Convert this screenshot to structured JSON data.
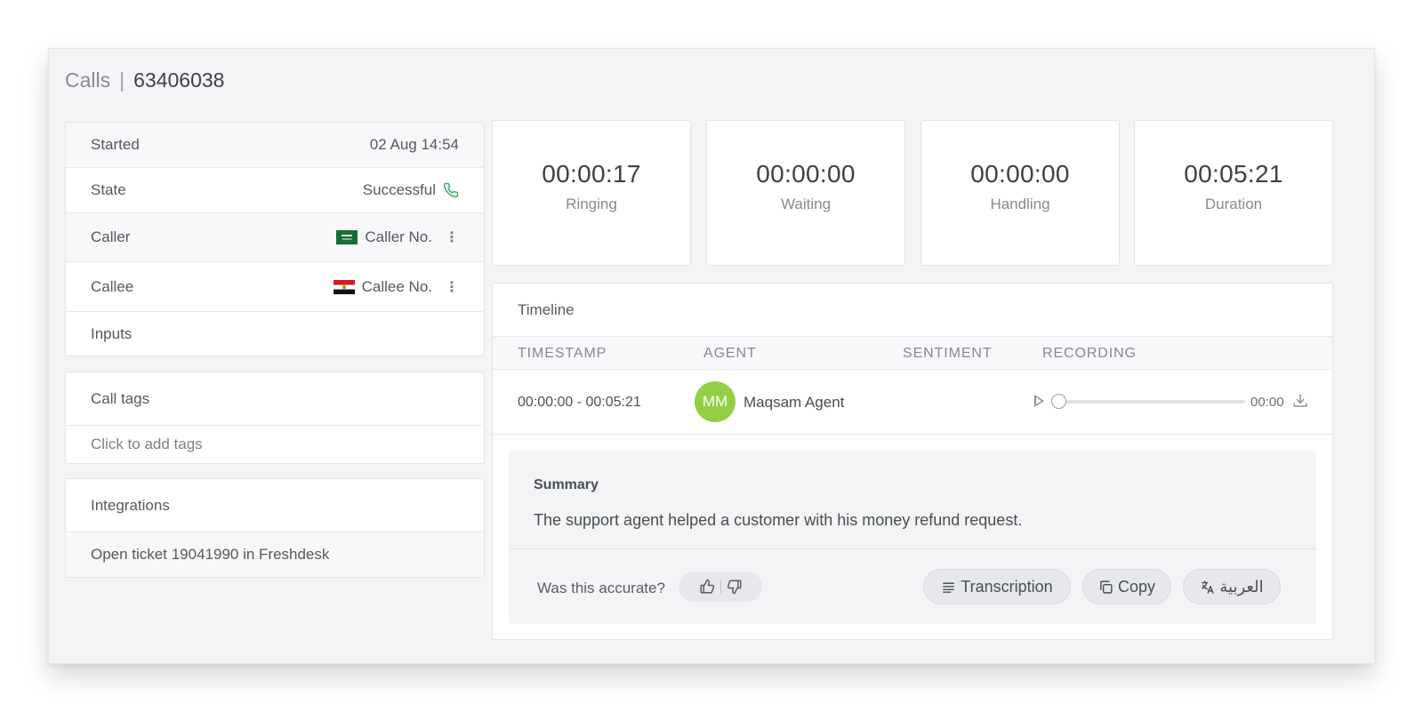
{
  "header": {
    "section": "Calls",
    "separator": "|",
    "call_id": "63406038"
  },
  "details": {
    "started": {
      "label": "Started",
      "value": "02 Aug 14:54"
    },
    "state": {
      "label": "State",
      "value": "Successful",
      "icon": "phone-icon",
      "icon_color": "#3fae6a"
    },
    "caller": {
      "label": "Caller",
      "value": "Caller No.",
      "flag": "saudi-arabia-flag-icon"
    },
    "callee": {
      "label": "Callee",
      "value": "Callee No.",
      "flag": "egypt-flag-icon"
    },
    "inputs": {
      "label": "Inputs"
    }
  },
  "call_tags": {
    "title": "Call tags",
    "placeholder": "Click to add tags"
  },
  "integrations": {
    "title": "Integrations",
    "item": "Open ticket 19041990 in Freshdesk"
  },
  "stats": [
    {
      "value": "00:00:17",
      "label": "Ringing"
    },
    {
      "value": "00:00:00",
      "label": "Waiting"
    },
    {
      "value": "00:00:00",
      "label": "Handling"
    },
    {
      "value": "00:05:21",
      "label": "Duration"
    }
  ],
  "timeline": {
    "title": "Timeline",
    "columns": {
      "timestamp": "TIMESTAMP",
      "agent": "AGENT",
      "sentiment": "SENTIMENT",
      "recording": "RECORDING"
    },
    "row": {
      "timestamp": "00:00:00 - 00:05:21",
      "agent_initials": "MM",
      "agent_name": "Maqsam Agent",
      "avatar_color": "#93cf45",
      "recording_time": "00:00",
      "recording_progress": 0
    }
  },
  "summary": {
    "title": "Summary",
    "text": "The support agent helped a customer with his money refund request.",
    "question": "Was this accurate?",
    "transcription_label": "Transcription",
    "copy_label": "Copy",
    "translate_label": "العربية"
  }
}
